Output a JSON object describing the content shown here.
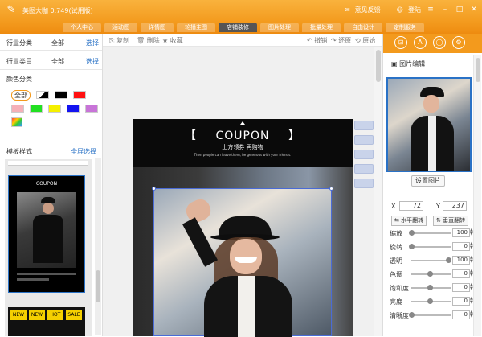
{
  "app": {
    "title": "美图大咖 0.749(试用版)",
    "feedback": "意见反馈",
    "login": "登陆"
  },
  "nav": {
    "tabs": [
      {
        "label": "个人中心"
      },
      {
        "label": "活动图"
      },
      {
        "label": "详情图"
      },
      {
        "label": "轮播主图"
      },
      {
        "label": "店铺装修",
        "active": true
      },
      {
        "label": "图片处理"
      },
      {
        "label": "批量处理"
      },
      {
        "label": "自由设计"
      },
      {
        "label": "定制服务"
      }
    ]
  },
  "left": {
    "industry_category_label": "行业分类",
    "industry_category_value": "全部",
    "industry_category_select": "选择",
    "industry_item_label": "行业类目",
    "industry_item_value": "全部",
    "industry_item_select": "选择",
    "color_category_label": "颜色分类",
    "color_all": "全部",
    "template_style_label": "模板样式",
    "fullscreen_select": "全屏选择",
    "swatch_colors": [
      "#ffffff",
      "#000000",
      "#ff1010",
      "#f5b0b8",
      "#22e022",
      "#f5f000",
      "#1414f0",
      "#c874d8"
    ]
  },
  "toolbar": {
    "copy": "复制",
    "delete": "删除",
    "favorite": "收藏",
    "undo": "撤销",
    "redo": "还原",
    "original": "原始"
  },
  "design": {
    "coupon_title": "COUPON",
    "bracket_left": "【",
    "bracket_right": "】",
    "coupon_sub": "上方领券 再购物",
    "coupon_tiny": "Then people can leave them, be generous with your friends."
  },
  "thumb": {
    "coupon_title": "COUPON",
    "b1": "NEW",
    "b2": "HOT",
    "b3": "SALE"
  },
  "right": {
    "image_edit_title": "图片编辑",
    "set_image": "设置图片",
    "x_label": "X",
    "x_value": "72",
    "y_label": "Y",
    "y_value": "237",
    "flip_h": "水平翻转",
    "flip_v": "垂直翻转",
    "sliders": [
      {
        "label": "缩放",
        "value": "100",
        "level": 0.0
      },
      {
        "label": "旋转",
        "value": "0",
        "level": 0.0
      },
      {
        "label": "透明",
        "value": "100",
        "level": 1.0
      },
      {
        "label": "色调",
        "value": "0",
        "level": 0.5
      },
      {
        "label": "饱和度",
        "value": "0",
        "level": 0.5
      },
      {
        "label": "亮度",
        "value": "0",
        "level": 0.5
      },
      {
        "label": "清晰度",
        "value": "0",
        "level": 0.0
      }
    ]
  },
  "colors": {
    "accent": "#f39a1d",
    "link": "#2a72c6"
  }
}
